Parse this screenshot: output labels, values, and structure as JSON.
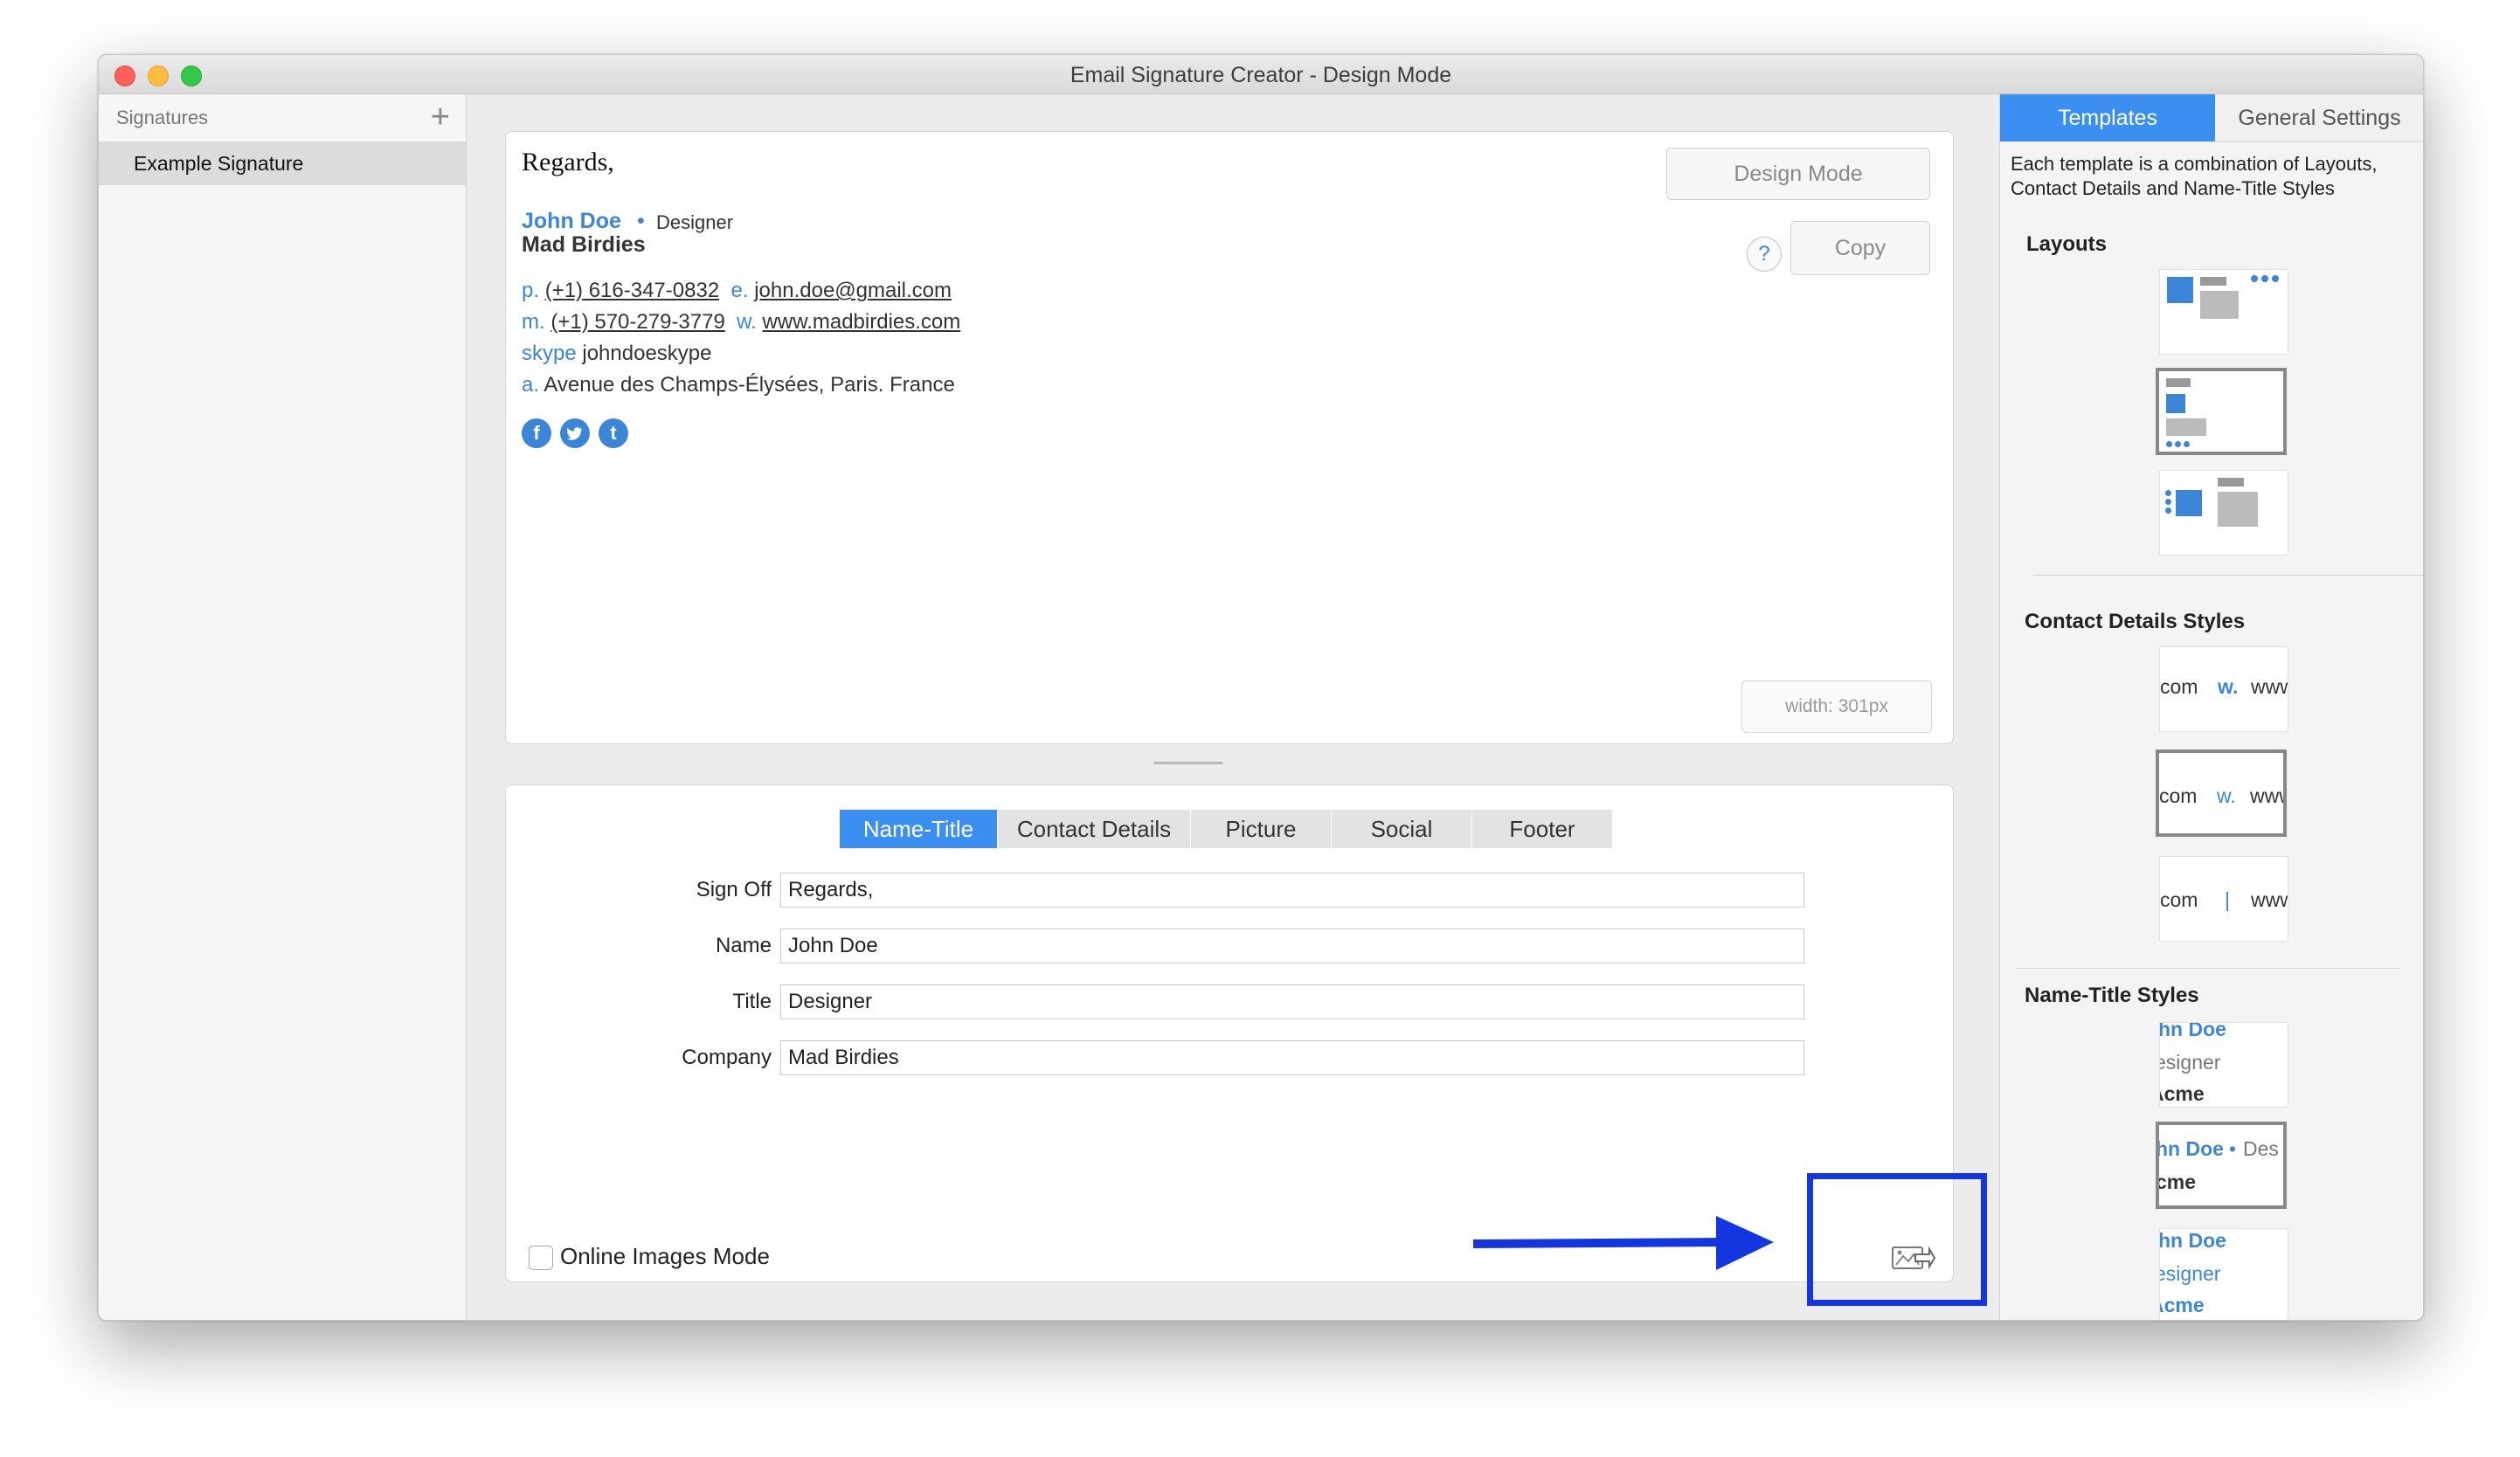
{
  "window": {
    "title": "Email Signature Creator - Design Mode"
  },
  "sidebar": {
    "title": "Signatures",
    "add_label": "+",
    "items": [
      {
        "label": "Example Signature"
      }
    ]
  },
  "preview": {
    "signoff": "Regards,",
    "name": "John Doe",
    "dot": "•",
    "title": "Designer",
    "company": "Mad Birdies",
    "phone_label": "p.",
    "phone": "(+1) 616-347-0832",
    "email_label": "e.",
    "email": "john.doe@gmail.com",
    "mobile_label": "m.",
    "mobile": "(+1) 570-279-3779",
    "web_label": "w.",
    "web": "www.madbirdies.com",
    "skype_label": "skype",
    "skype": "johndoeskype",
    "address_label": "a.",
    "address": "Avenue des Champs-Élysées, Paris. France",
    "social_icons": [
      {
        "name": "facebook-icon",
        "glyph": "f"
      },
      {
        "name": "twitter-icon",
        "glyph": "t"
      },
      {
        "name": "tumblr-icon",
        "glyph": "t"
      }
    ],
    "design_mode_label": "Design Mode",
    "help_label": "?",
    "copy_label": "Copy",
    "width_label": "width: 301px"
  },
  "editor": {
    "tabs": [
      "Name-Title",
      "Contact Details",
      "Picture",
      "Social",
      "Footer"
    ],
    "active_tab": "Name-Title",
    "fields": [
      {
        "label": "Sign Off",
        "value": "Regards,"
      },
      {
        "label": "Name",
        "value": "John Doe"
      },
      {
        "label": "Title",
        "value": "Designer"
      },
      {
        "label": "Company",
        "value": "Mad Birdies"
      }
    ],
    "online_images_label": "Online Images Mode",
    "online_images_checked": false,
    "export_icon": "export-images-icon"
  },
  "right_panel": {
    "tabs": [
      "Templates",
      "General Settings"
    ],
    "active_tab": "Templates",
    "description": "Each template is a combination of Layouts, Contact Details and Name-Title Styles",
    "layouts_title": "Layouts",
    "contact_styles_title": "Contact Details Styles",
    "name_title_styles_title": "Name-Title Styles",
    "contact_samples": [
      {
        "left": "com",
        "sep": "w.",
        "right": "www"
      },
      {
        "left": "com",
        "sep": "w.",
        "right": "www"
      },
      {
        "left": "com",
        "sep": "|",
        "right": "www"
      }
    ],
    "name_samples": [
      {
        "line1": "hn Doe",
        "line2": "esigner",
        "line3": "Acme"
      },
      {
        "line1": "hn Doe",
        "dot": "•",
        "title": "Des",
        "line2": "cme"
      },
      {
        "line1": "hn Doe",
        "line2": "esigner",
        "line3": "Acme"
      }
    ]
  },
  "colors": {
    "accent": "#3b8ff0",
    "link_blue": "#3b86d9",
    "annotation": "#1436e0"
  }
}
